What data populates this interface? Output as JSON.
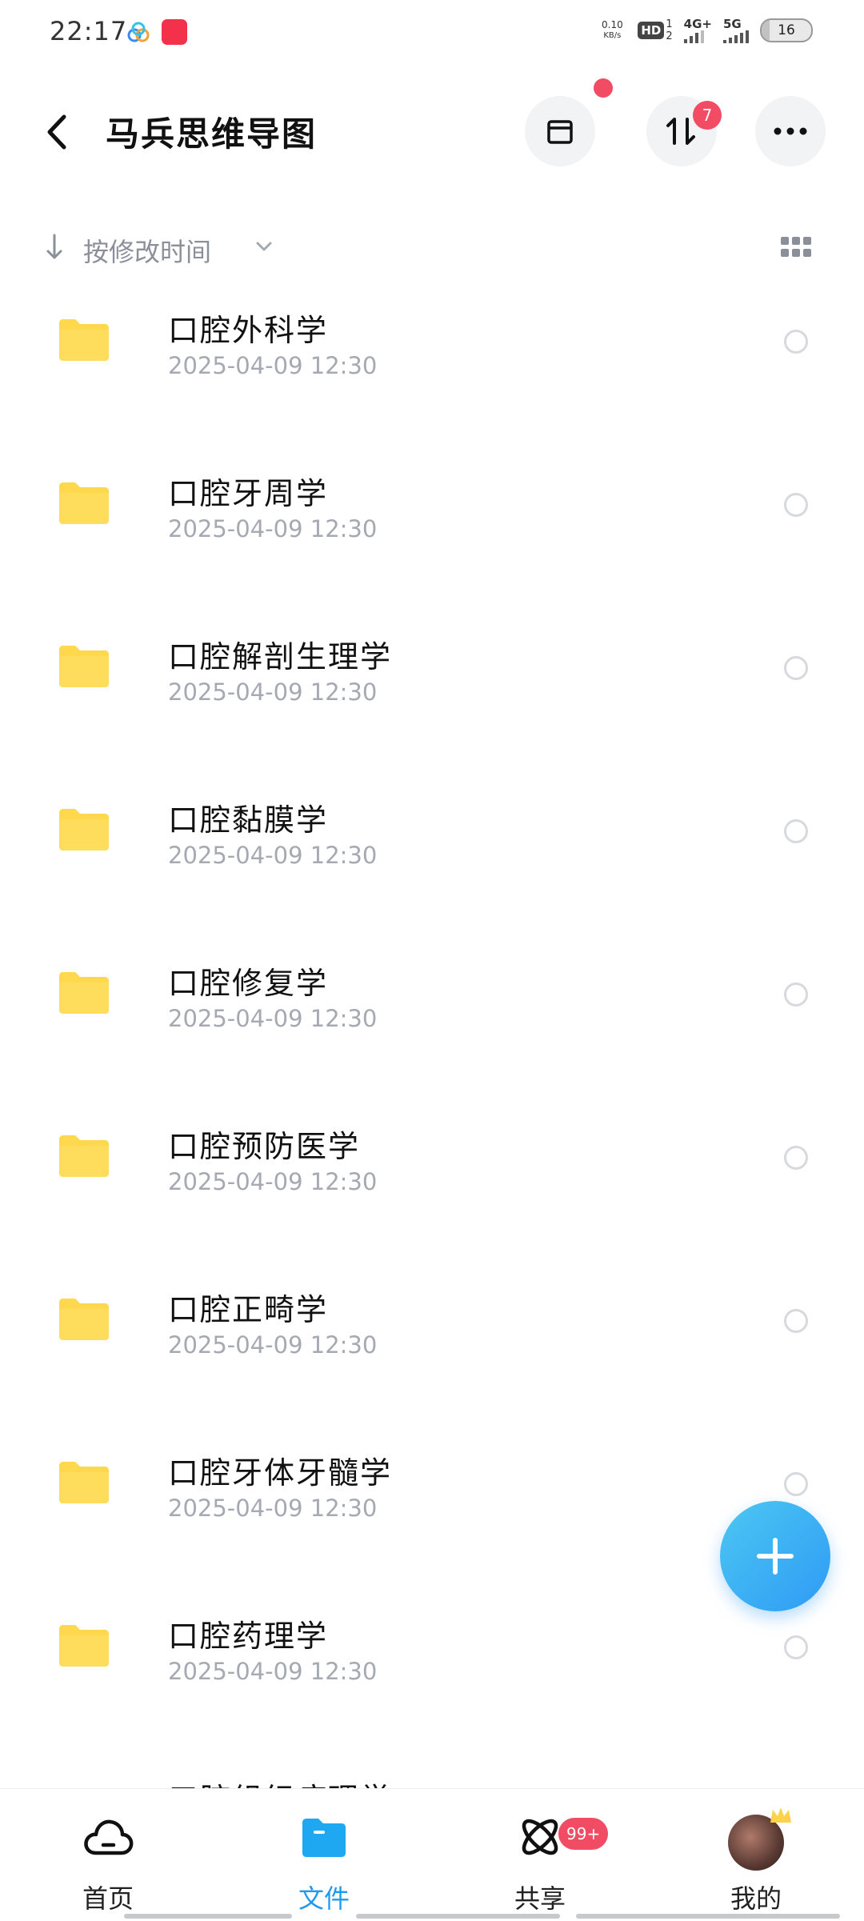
{
  "status_bar": {
    "time": "22:17",
    "net_speed_value": "0.10",
    "net_speed_unit": "KB/s",
    "hd_label": "HD",
    "hd_nums": "1\n2",
    "signal1_label": "4G+",
    "signal2_label": "5G",
    "battery_level": 16,
    "battery_text": "16"
  },
  "header": {
    "title": "马兵思维导图",
    "transfer_badge": "7"
  },
  "sort_bar": {
    "label": "按修改时间"
  },
  "files": [
    {
      "name": "口腔外科学",
      "date": "2025-04-09 12:30"
    },
    {
      "name": "口腔牙周学",
      "date": "2025-04-09 12:30"
    },
    {
      "name": "口腔解剖生理学",
      "date": "2025-04-09 12:30"
    },
    {
      "name": "口腔黏膜学",
      "date": "2025-04-09 12:30"
    },
    {
      "name": "口腔修复学",
      "date": "2025-04-09 12:30"
    },
    {
      "name": "口腔预防医学",
      "date": "2025-04-09 12:30"
    },
    {
      "name": "口腔正畸学",
      "date": "2025-04-09 12:30"
    },
    {
      "name": "口腔牙体牙髓学",
      "date": "2025-04-09 12:30"
    },
    {
      "name": "口腔药理学",
      "date": "2025-04-09 12:30"
    },
    {
      "name": "口腔组织病理学",
      "date": ""
    }
  ],
  "bottom_nav": {
    "home": "首页",
    "files": "文件",
    "share": "共享",
    "mine": "我的",
    "share_badge": "99+",
    "active": "files"
  },
  "colors": {
    "accent": "#1e9bf0",
    "folder": "#ffd84d",
    "badge": "#f24b64",
    "date_text": "#a5a9b2"
  }
}
